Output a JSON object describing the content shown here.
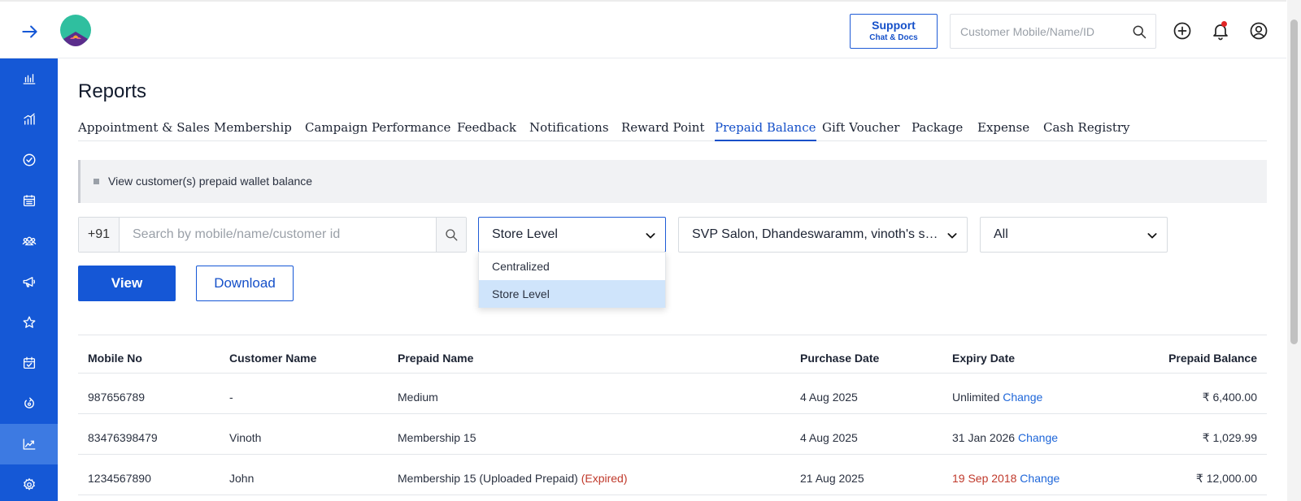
{
  "header": {
    "support_title": "Support",
    "support_sub": "Chat & Docs",
    "search_placeholder": "Customer Mobile/Name/ID"
  },
  "sidebar": {
    "items": [
      {
        "icon": "bar-chart-icon"
      },
      {
        "icon": "analytics-icon"
      },
      {
        "icon": "check-circle-icon"
      },
      {
        "icon": "calendar-icon"
      },
      {
        "icon": "customers-icon"
      },
      {
        "icon": "megaphone-icon"
      },
      {
        "icon": "star-icon"
      },
      {
        "icon": "calendar-check-icon"
      },
      {
        "icon": "refresh-icon"
      },
      {
        "icon": "reports-icon",
        "active": true
      },
      {
        "icon": "settings-icon"
      }
    ]
  },
  "page": {
    "title": "Reports",
    "tabs": [
      "Appointment & Sales",
      "Membership",
      "Campaign Performance",
      "Feedback",
      "Notifications",
      "Reward Point",
      "Prepaid Balance",
      "Gift Voucher",
      "Package",
      "Expense",
      "Cash Registry"
    ],
    "active_tab": "Prepaid Balance",
    "info": "View customer(s) prepaid wallet balance"
  },
  "filters": {
    "country_code": "+91",
    "search_placeholder": "Search by mobile/name/customer id",
    "level_value": "Store Level",
    "level_options": [
      "Centralized",
      "Store Level"
    ],
    "stores_value": "SVP Salon, Dhandeswaramm, vinoth's salo...",
    "status_value": "All",
    "view_label": "View",
    "download_label": "Download"
  },
  "table": {
    "headers": [
      "Mobile No",
      "Customer Name",
      "Prepaid Name",
      "Purchase Date",
      "Expiry Date",
      "Prepaid Balance"
    ],
    "rows": [
      {
        "mobile": "987656789",
        "name": "-",
        "prepaid": "Medium",
        "expired_tag": "",
        "purchase": "4 Aug 2025",
        "expiry": "Unlimited",
        "expiry_expired": false,
        "change": "Change",
        "balance": "₹ 6,400.00"
      },
      {
        "mobile": "83476398479",
        "name": "Vinoth",
        "prepaid": "Membership 15",
        "expired_tag": "",
        "purchase": "4 Aug 2025",
        "expiry": "31 Jan 2026",
        "expiry_expired": false,
        "change": "Change",
        "balance": "₹ 1,029.99"
      },
      {
        "mobile": "1234567890",
        "name": "John",
        "prepaid": "Membership 15 (Uploaded Prepaid)",
        "expired_tag": "(Expired)",
        "purchase": "21 Aug 2025",
        "expiry": "19 Sep 2018",
        "expiry_expired": true,
        "change": "Change",
        "balance": "₹ 12,000.00"
      }
    ]
  },
  "colors": {
    "primary": "#1557d6",
    "sidebar_active": "#3d7ae2",
    "expired": "#c0392b",
    "dropdown_selected": "#cfe4fb"
  }
}
